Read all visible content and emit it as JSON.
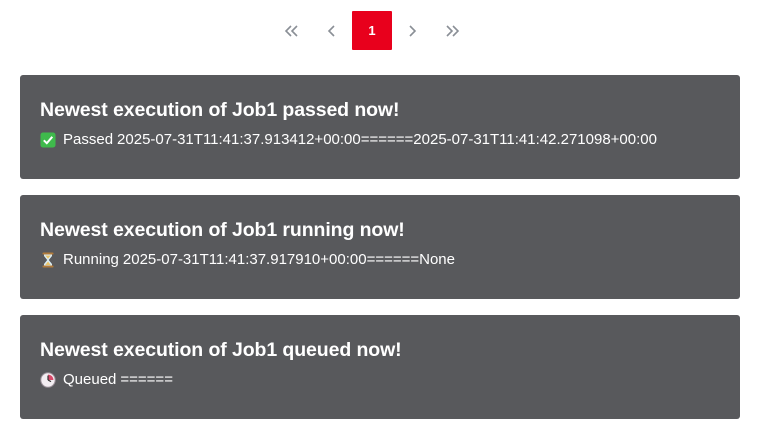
{
  "pagination": {
    "first_icon": "double-chevron-left-icon",
    "prev_icon": "chevron-left-icon",
    "current_page": "1",
    "next_icon": "chevron-right-icon",
    "last_icon": "double-chevron-right-icon",
    "active_color": "#e8001c"
  },
  "executions": [
    {
      "title": "Newest execution of Job1 passed now!",
      "status_icon": "check-mark-icon",
      "status_label": "Passed",
      "detail": "2025-07-31T11:41:37.913412+00:00======2025-07-31T11:41:42.271098+00:00"
    },
    {
      "title": "Newest execution of Job1 running now!",
      "status_icon": "hourglass-icon",
      "status_label": "Running",
      "detail": "2025-07-31T11:41:37.917910+00:00======None"
    },
    {
      "title": "Newest execution of Job1 queued now!",
      "status_icon": "clock-icon",
      "status_label": "Queued",
      "detail": "======"
    }
  ],
  "card_color": "#58595c"
}
